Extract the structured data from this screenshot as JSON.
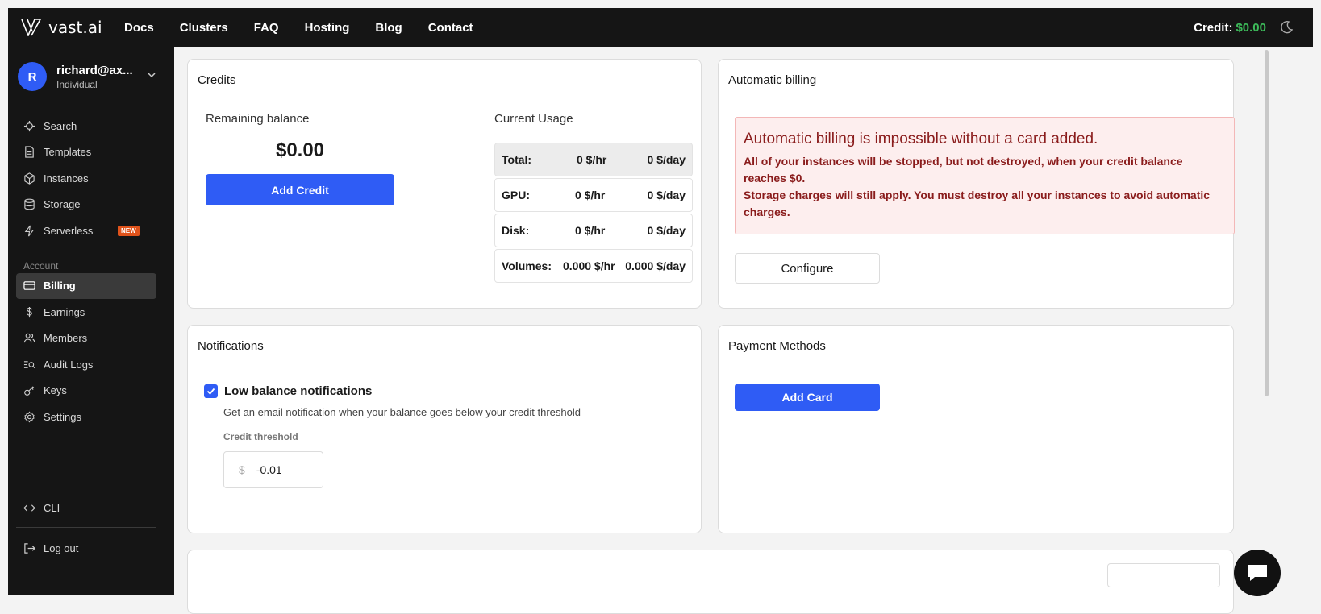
{
  "topbar": {
    "brand": "vast.ai",
    "nav": [
      "Docs",
      "Clusters",
      "FAQ",
      "Hosting",
      "Blog",
      "Contact"
    ],
    "credit_label": "Credit:",
    "credit_value": "$0.00"
  },
  "sidebar": {
    "user": {
      "initial": "R",
      "email": "richard@ax...",
      "role": "Individual"
    },
    "items": [
      {
        "label": "Search",
        "icon": "search-icon"
      },
      {
        "label": "Templates",
        "icon": "file-icon"
      },
      {
        "label": "Instances",
        "icon": "cube-icon"
      },
      {
        "label": "Storage",
        "icon": "database-icon"
      },
      {
        "label": "Serverless",
        "icon": "lightning-icon",
        "badge": "NEW"
      }
    ],
    "account_label": "Account",
    "account_items": [
      {
        "label": "Billing",
        "icon": "card-icon",
        "active": true
      },
      {
        "label": "Earnings",
        "icon": "dollar-icon"
      },
      {
        "label": "Members",
        "icon": "users-icon"
      },
      {
        "label": "Audit Logs",
        "icon": "list-search-icon"
      },
      {
        "label": "Keys",
        "icon": "key-icon"
      },
      {
        "label": "Settings",
        "icon": "gear-icon"
      }
    ],
    "cli": "CLI",
    "logout": "Log out"
  },
  "credits": {
    "title": "Credits",
    "remaining_label": "Remaining balance",
    "balance": "$0.00",
    "add_credit": "Add Credit",
    "usage_label": "Current Usage",
    "usage": [
      {
        "name": "Total:",
        "hr": "0 $/hr",
        "day": "0 $/day"
      },
      {
        "name": "GPU:",
        "hr": "0 $/hr",
        "day": "0 $/day"
      },
      {
        "name": "Disk:",
        "hr": "0 $/hr",
        "day": "0 $/day"
      },
      {
        "name": "Volumes:",
        "hr": "0.000 $/hr",
        "day": "0.000 $/day"
      }
    ]
  },
  "auto_billing": {
    "title": "Automatic billing",
    "alert_title": "Automatic billing is impossible without a card added.",
    "alert_line1": "All of your instances will be stopped, but not destroyed, when your credit balance reaches $0.",
    "alert_line2": "Storage charges will still apply. You must destroy all your instances to avoid automatic charges.",
    "configure": "Configure"
  },
  "notifications": {
    "title": "Notifications",
    "checkbox_label": "Low balance notifications",
    "checked": true,
    "help": "Get an email notification when your balance goes below your credit threshold",
    "threshold_label": "Credit threshold",
    "currency": "$",
    "threshold_value": "-0.01"
  },
  "payment": {
    "title": "Payment Methods",
    "add_card": "Add Card"
  },
  "colors": {
    "accent": "#2f5cf5",
    "credit": "#3dbb5a",
    "alert_bg": "#fdeeee",
    "alert_text": "#8a1c1c",
    "badge": "#e0531b"
  }
}
